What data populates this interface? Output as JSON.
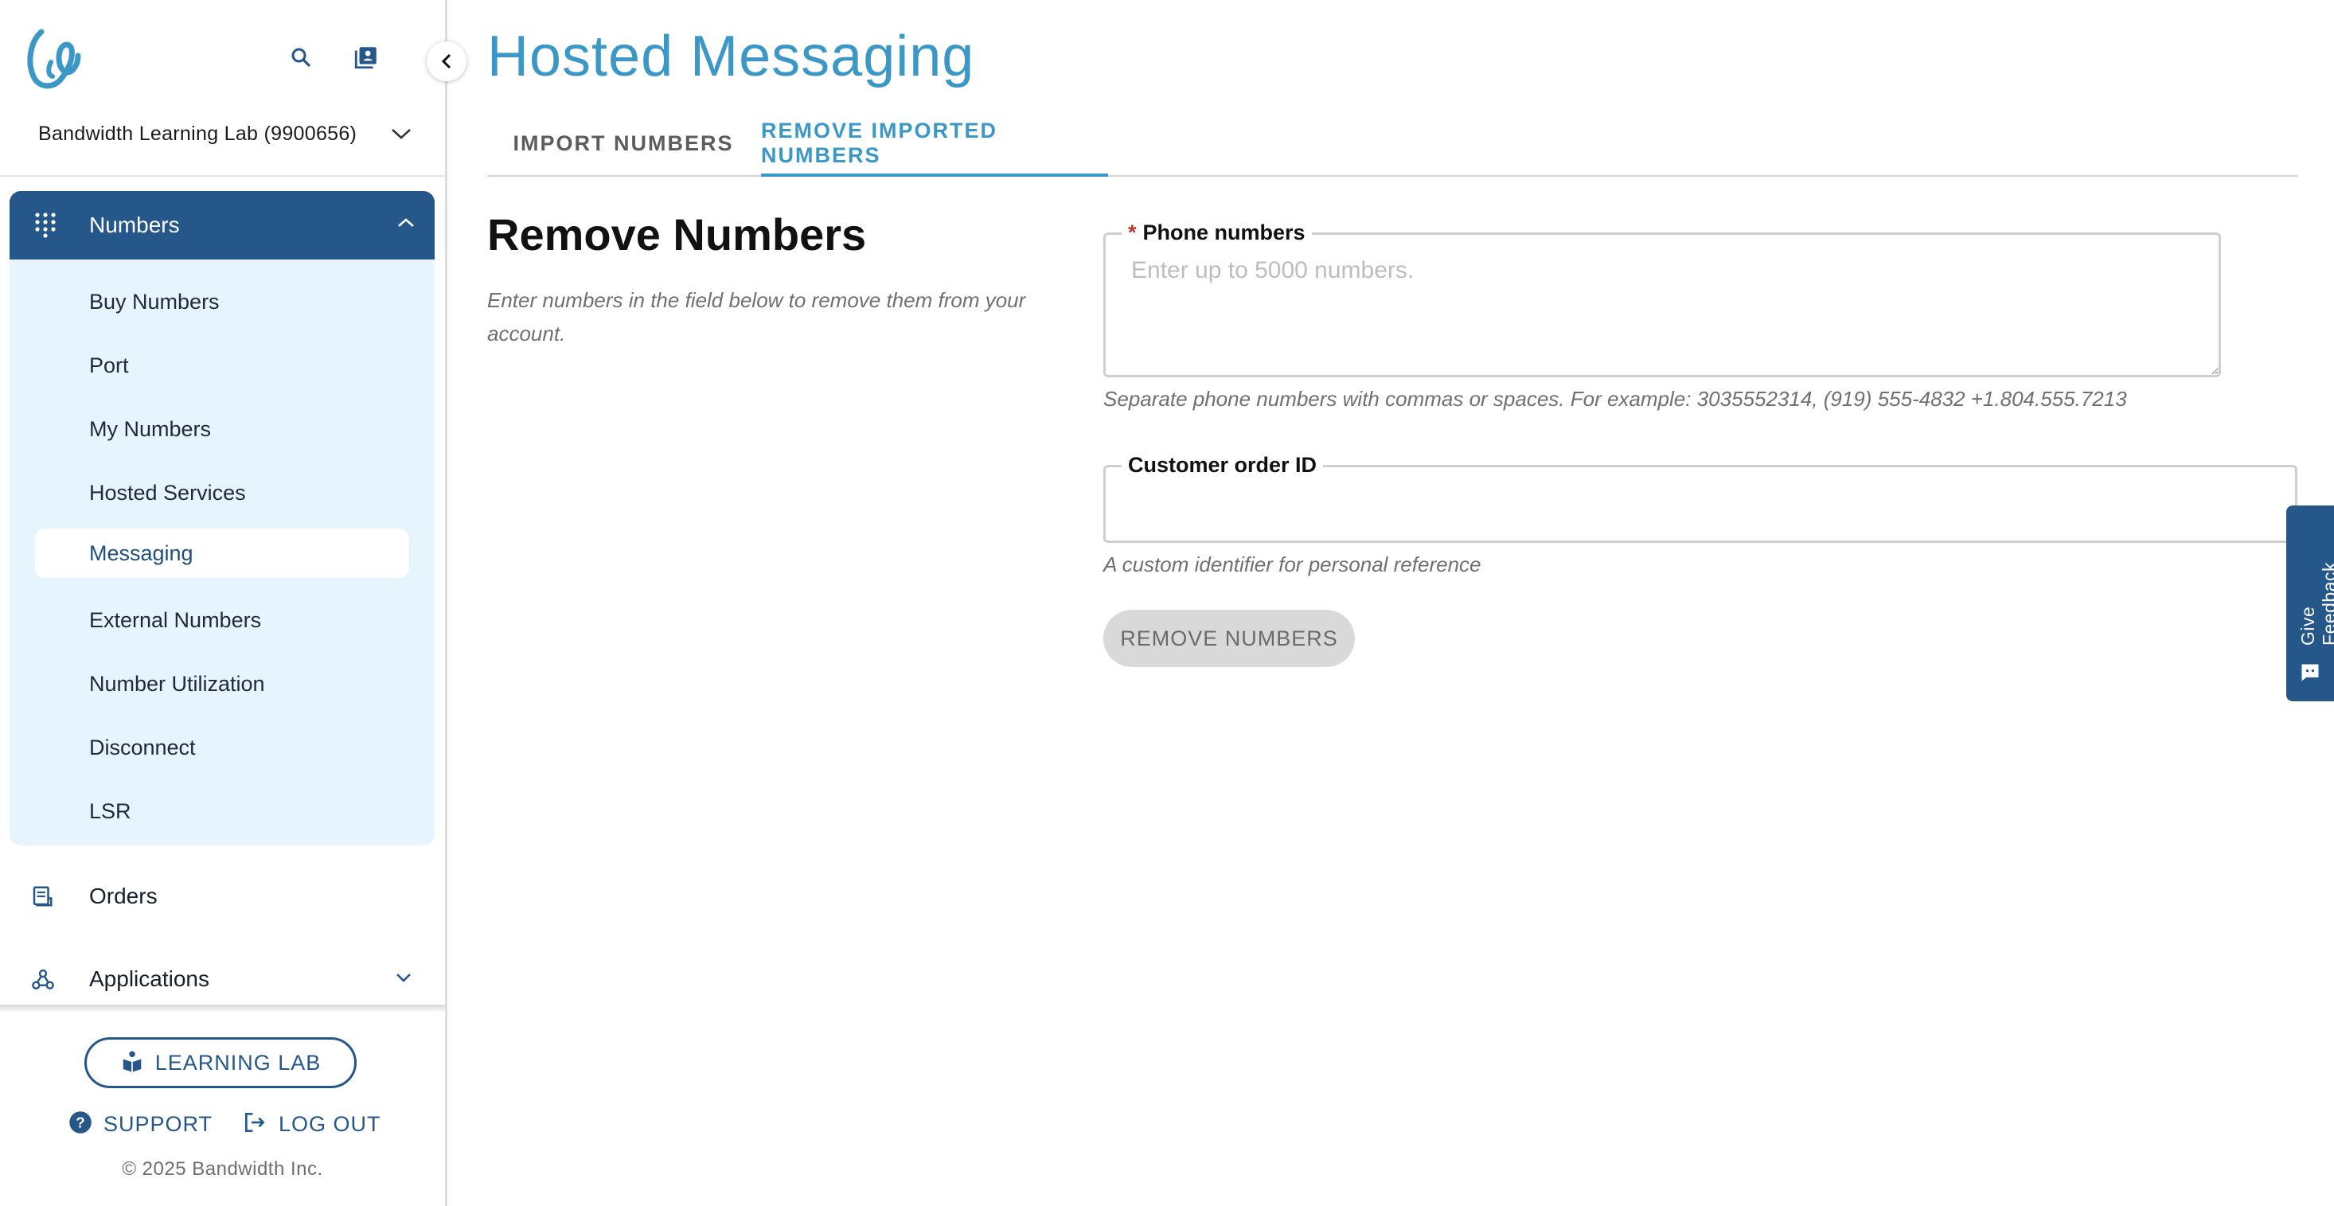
{
  "app": {
    "account_selector": "Bandwidth Learning Lab (9900656)"
  },
  "sidebar": {
    "numbers_group": {
      "label": "Numbers",
      "items": [
        {
          "label": "Buy Numbers"
        },
        {
          "label": "Port"
        },
        {
          "label": "My Numbers"
        },
        {
          "label": "Hosted Services"
        },
        {
          "label": "Messaging",
          "active": true
        },
        {
          "label": "External Numbers"
        },
        {
          "label": "Number Utilization"
        },
        {
          "label": "Disconnect"
        },
        {
          "label": "LSR"
        }
      ]
    },
    "orders_label": "Orders",
    "applications_label": "Applications",
    "learning_lab_label": "LEARNING LAB",
    "support_label": "SUPPORT",
    "logout_label": "LOG OUT",
    "copyright": "© 2025 Bandwidth Inc."
  },
  "page": {
    "title": "Hosted Messaging",
    "tabs": [
      {
        "label": "IMPORT NUMBERS",
        "active": false
      },
      {
        "label": "REMOVE IMPORTED NUMBERS",
        "active": true
      }
    ]
  },
  "form": {
    "section_title": "Remove Numbers",
    "section_description": "Enter numbers in the field below to remove them from your account.",
    "phone_label": "Phone numbers",
    "phone_required_marker": "*",
    "phone_placeholder": "Enter up to 5000 numbers.",
    "phone_value": "",
    "phone_helper": "Separate phone numbers with commas or spaces. For example: 3035552314, (919) 555-4832 +1.804.555.7213",
    "order_label": "Customer order ID",
    "order_value": "",
    "order_helper": "A custom identifier for personal reference",
    "submit_label": "REMOVE NUMBERS"
  },
  "feedback": {
    "label": "Give Feedback"
  },
  "colors": {
    "brand_navy": "#25578a",
    "accent_blue": "#3a97c6",
    "nav_bg": "#e6f4fd",
    "required_red": "#c0392b",
    "disabled_button": "#d9d9d9"
  },
  "icons": {
    "search": "search-icon",
    "directory": "contact-book-icon",
    "collapse": "chevron-left-icon",
    "numbers": "dialpad-icon",
    "orders": "receipt-icon",
    "applications": "webhook-icon",
    "learning_lab": "reading-book-icon",
    "support": "help-circle-icon",
    "logout": "logout-icon",
    "feedback": "chat-icon"
  }
}
